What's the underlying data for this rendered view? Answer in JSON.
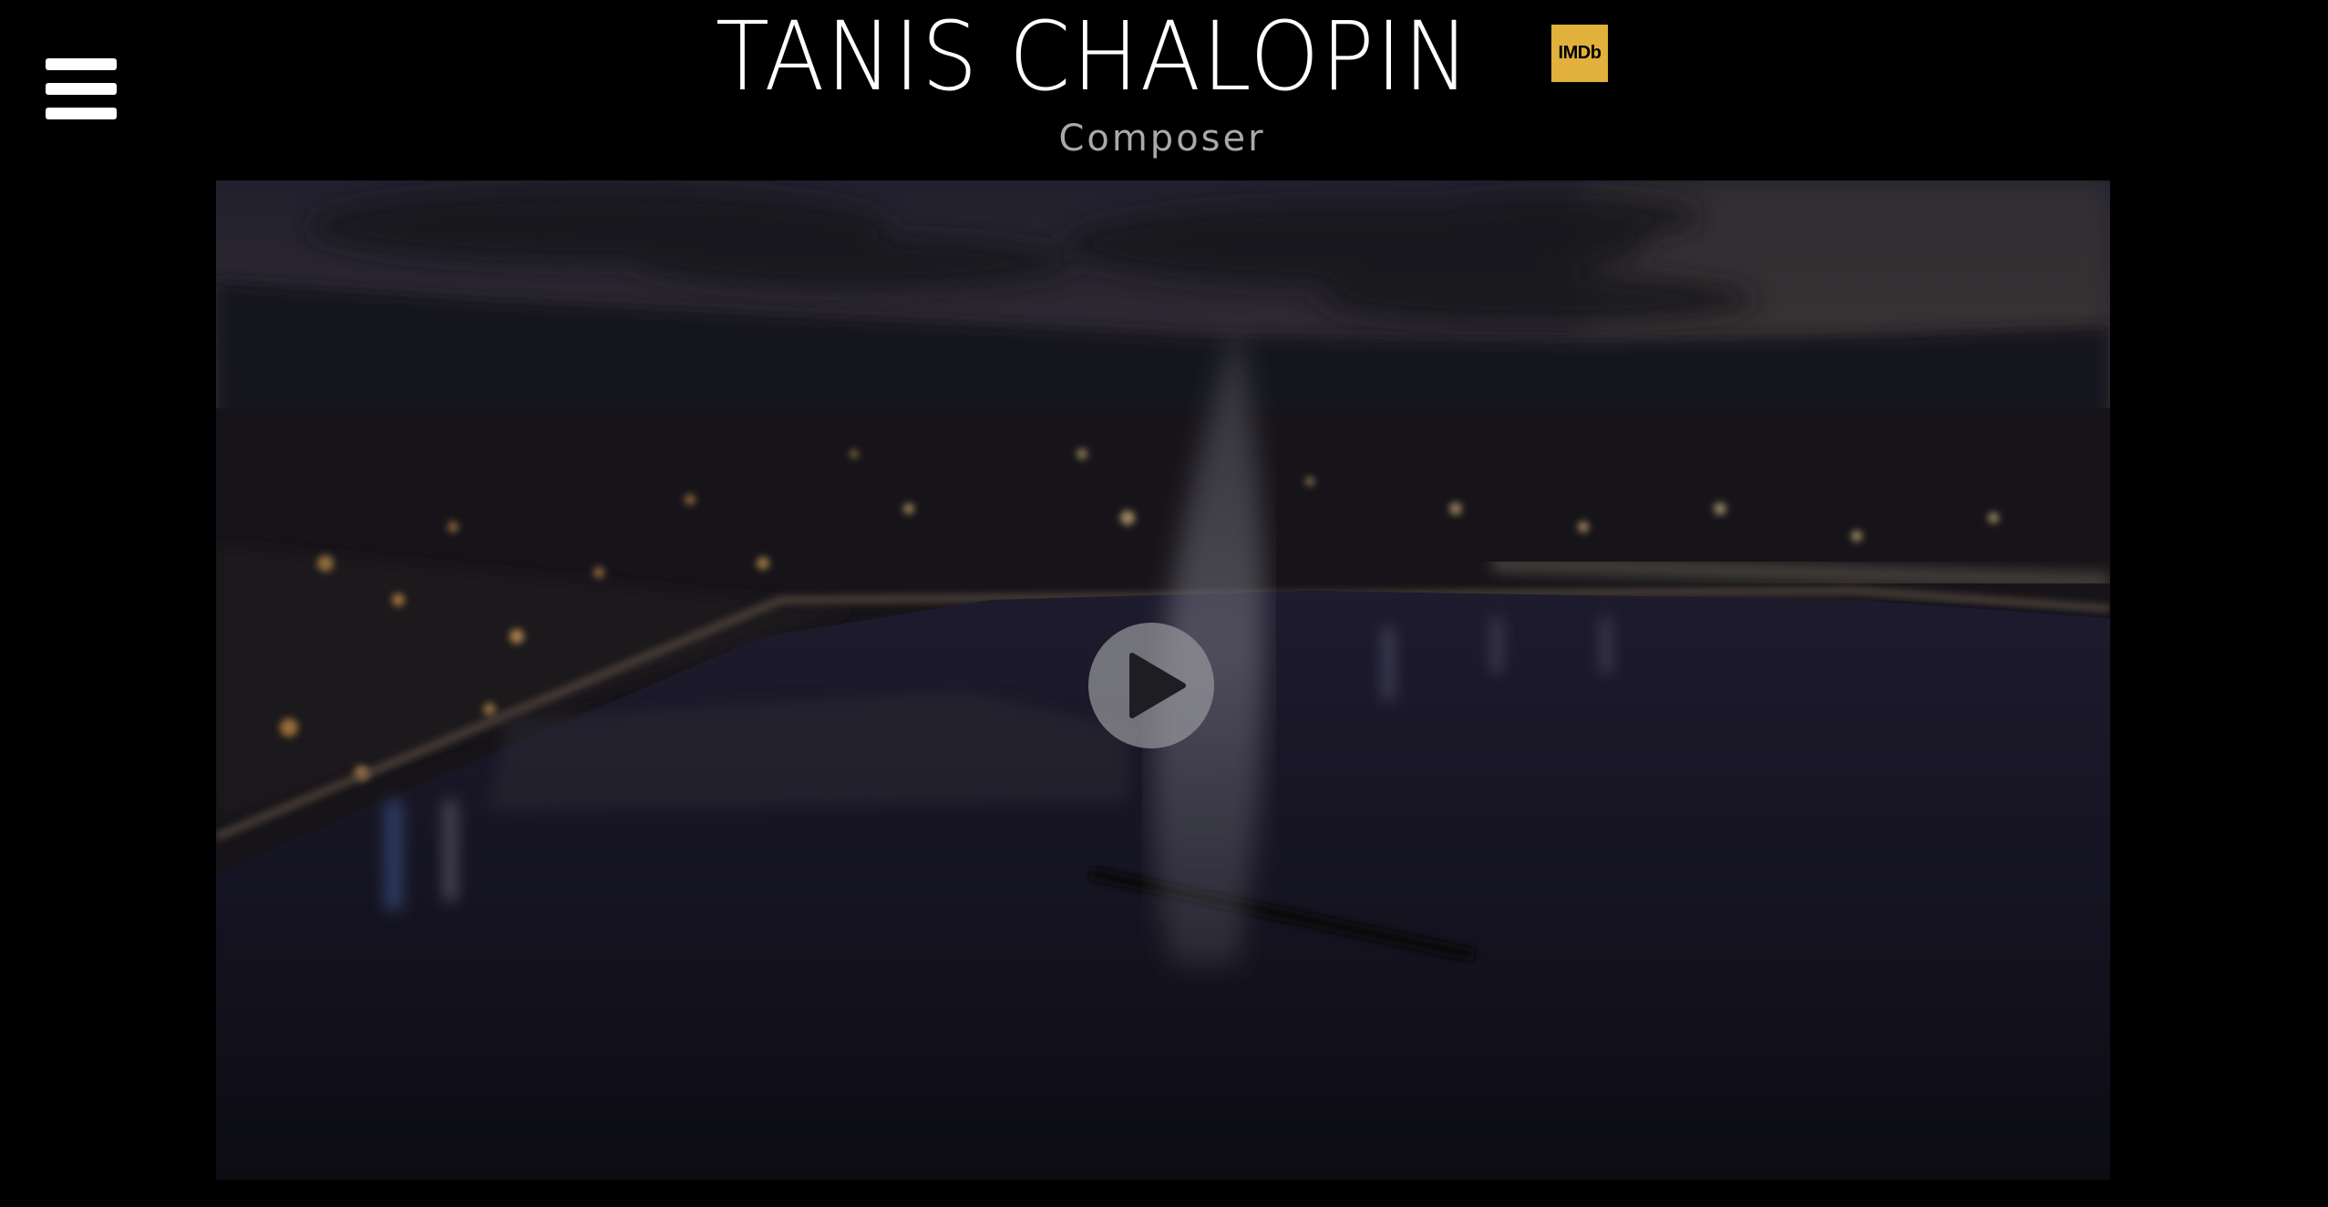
{
  "header": {
    "title": "TANIS CHALOPIN",
    "imdb_label": "IMDb",
    "subtitle": "Composer"
  },
  "icons": {
    "menu": "hamburger-menu-icon",
    "play": "play-icon"
  },
  "colors": {
    "background": "#000000",
    "title": "#ffffff",
    "subtitle": "#a9a9a9",
    "imdb_badge": "#e2b13c",
    "play_button": "#96969b"
  }
}
